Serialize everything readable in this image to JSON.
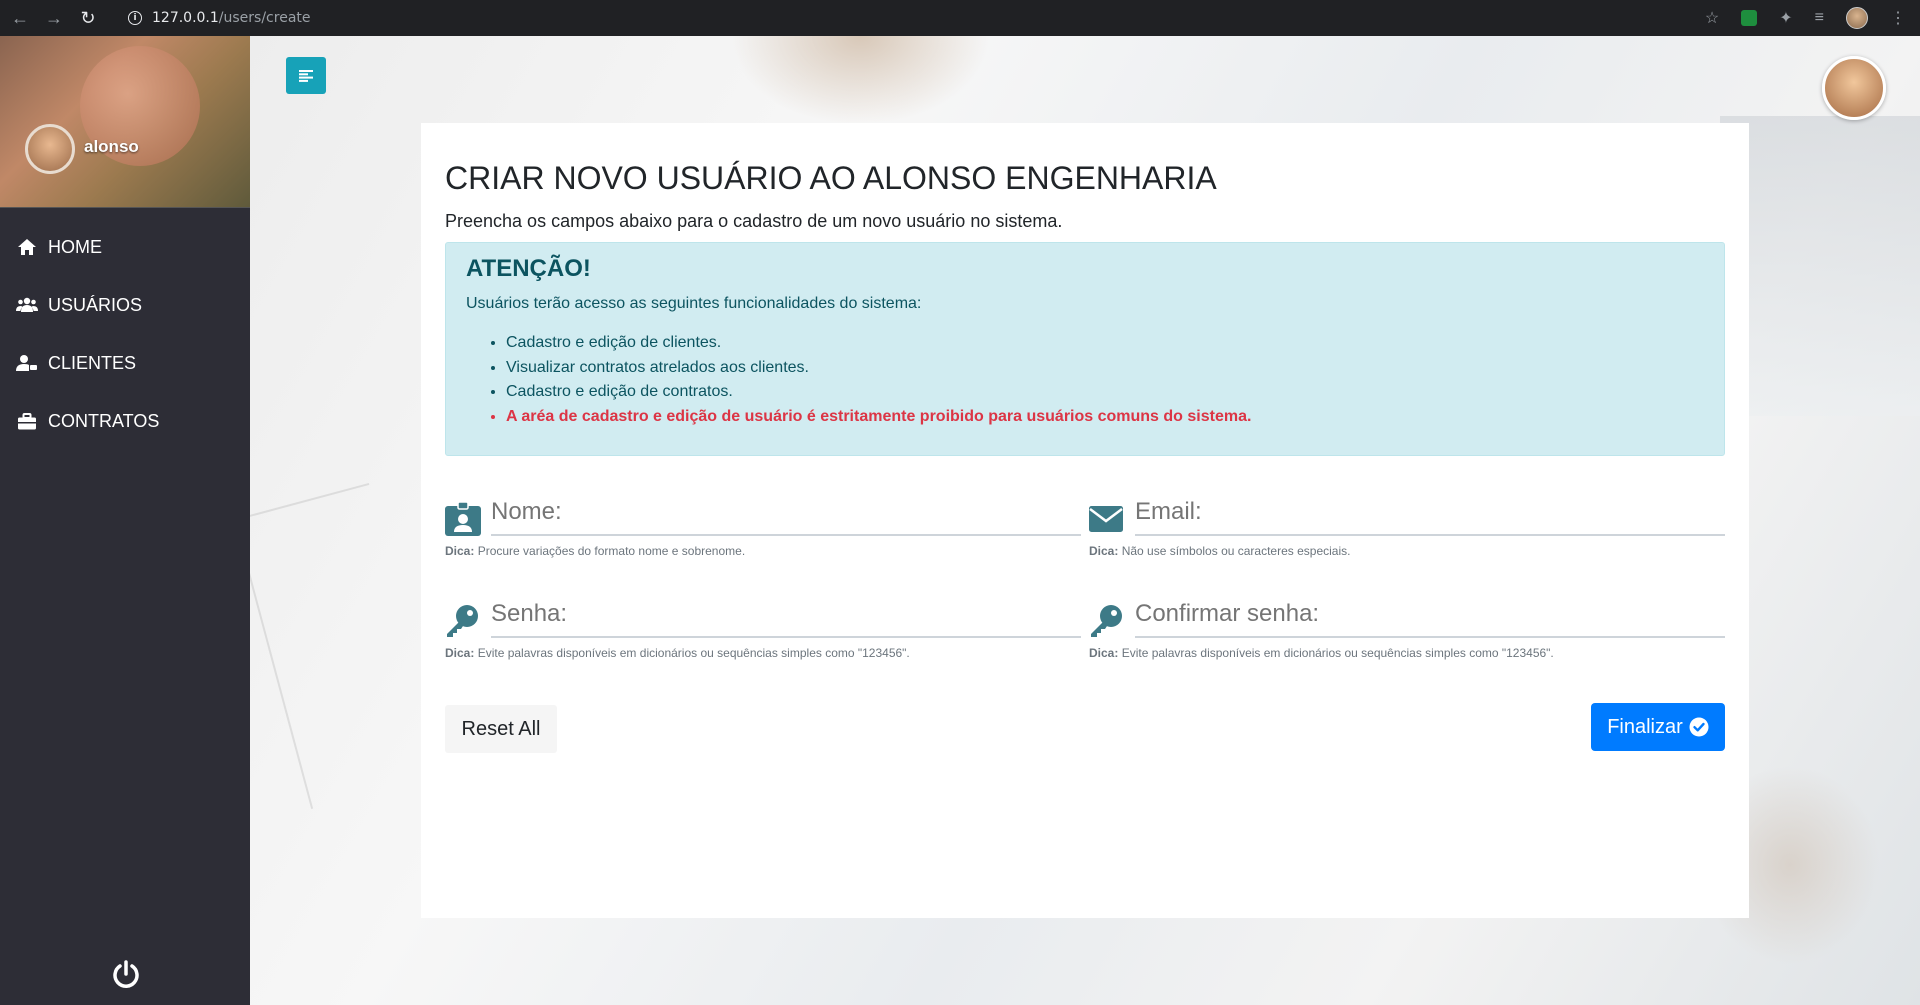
{
  "browser": {
    "url_host": "127.0.0.1",
    "url_path": "/users/create",
    "back_icon": "arrow-left-icon",
    "forward_icon": "arrow-right-icon",
    "reload_icon": "reload-icon"
  },
  "sidebar": {
    "username": "alonso",
    "items": [
      {
        "label": "HOME",
        "icon": "home-icon"
      },
      {
        "label": "USUÁRIOS",
        "icon": "users-icon"
      },
      {
        "label": "CLIENTES",
        "icon": "user-tag-icon"
      },
      {
        "label": "CONTRATOS",
        "icon": "briefcase-icon"
      }
    ],
    "logout_icon": "power-icon"
  },
  "page": {
    "title": "CRIAR NOVO USUÁRIO AO ALONSO ENGENHARIA",
    "subtitle": "Preencha os campos abaixo para o cadastro de um novo usuário no sistema.",
    "alert": {
      "heading": "ATENÇÃO!",
      "intro": "Usuários terão acesso as seguintes funcionalidades do sistema:",
      "items": [
        "Cadastro e edição de clientes.",
        "Visualizar contratos atrelados aos clientes.",
        "Cadastro e edição de contratos.",
        "A aréa de cadastro e edição de usuário é estritamente proibido para usuários comuns do sistema."
      ]
    },
    "form": {
      "name": {
        "placeholder": "Nome:",
        "hint_label": "Dica:",
        "hint": "Procure variações do formato nome e sobrenome."
      },
      "email": {
        "placeholder": "Email:",
        "hint_label": "Dica:",
        "hint": "Não use símbolos ou caracteres especiais."
      },
      "password": {
        "placeholder": "Senha:",
        "hint_label": "Dica:",
        "hint": "Evite palavras disponíveis em dicionários ou sequências simples como \"123456\"."
      },
      "confirm": {
        "placeholder": "Confirmar senha:",
        "hint_label": "Dica:",
        "hint": "Evite palavras disponíveis em dicionários ou sequências simples como \"123456\"."
      }
    },
    "buttons": {
      "reset": "Reset All",
      "submit": "Finalizar"
    }
  },
  "colors": {
    "sidebar_bg": "#2d2d36",
    "toggle": "#17a2b8",
    "alert_bg": "#d1ecf1",
    "alert_text": "#0c5460",
    "danger": "#dc3545",
    "primary": "#007bff",
    "field_icon": "#3d7a87"
  }
}
